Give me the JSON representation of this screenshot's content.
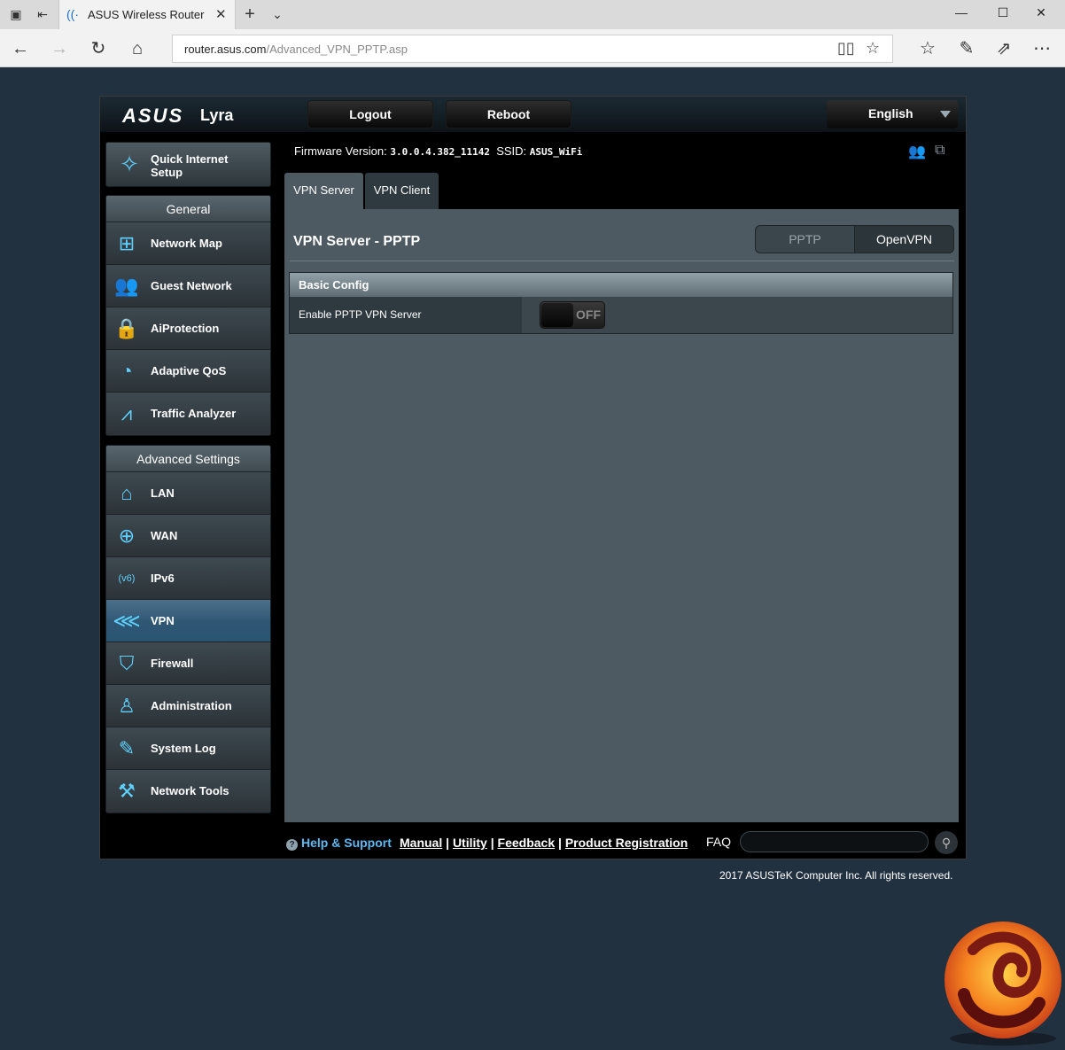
{
  "browser": {
    "tab_title": "ASUS Wireless Router Ly",
    "url_host": "router.asus.com",
    "url_path": "/Advanced_VPN_PPTP.asp"
  },
  "header": {
    "brand": "ASUS",
    "model": "Lyra",
    "logout_label": "Logout",
    "reboot_label": "Reboot",
    "language": "English"
  },
  "sidebar": {
    "quick_setup_line1": "Quick Internet",
    "quick_setup_line2": "Setup",
    "general_title": "General",
    "general_items": [
      {
        "label": "Network Map",
        "icon": "network-map-icon"
      },
      {
        "label": "Guest Network",
        "icon": "guest-network-icon"
      },
      {
        "label": "AiProtection",
        "icon": "lock-icon"
      },
      {
        "label": "Adaptive QoS",
        "icon": "speedometer-icon"
      },
      {
        "label": "Traffic Analyzer",
        "icon": "chart-icon"
      }
    ],
    "advanced_title": "Advanced Settings",
    "advanced_items": [
      {
        "label": "LAN",
        "icon": "home-icon"
      },
      {
        "label": "WAN",
        "icon": "globe-icon"
      },
      {
        "label": "IPv6",
        "icon": "ipv6-icon"
      },
      {
        "label": "VPN",
        "icon": "vpn-icon",
        "active": true
      },
      {
        "label": "Firewall",
        "icon": "shield-icon"
      },
      {
        "label": "Administration",
        "icon": "admin-icon"
      },
      {
        "label": "System Log",
        "icon": "log-icon"
      },
      {
        "label": "Network Tools",
        "icon": "tools-icon"
      }
    ]
  },
  "status": {
    "firmware_label": "Firmware Version:",
    "firmware_value": "3.0.0.4.382_11142",
    "ssid_label": "SSID:",
    "ssid_value": "ASUS_WiFi"
  },
  "tabs": {
    "vpn_server": "VPN Server",
    "vpn_client": "VPN Client"
  },
  "content": {
    "title": "VPN Server - PPTP",
    "seg_pptp": "PPTP",
    "seg_openvpn": "OpenVPN",
    "section_title": "Basic Config",
    "enable_label": "Enable PPTP VPN Server",
    "toggle_state": "OFF"
  },
  "footer": {
    "help": "Help & Support",
    "manual": "Manual",
    "utility": "Utility",
    "feedback": "Feedback",
    "product_registration": "Product Registration",
    "sep": "|",
    "faq": "FAQ",
    "copyright": "2017 ASUSTeK Computer Inc. All rights reserved."
  }
}
